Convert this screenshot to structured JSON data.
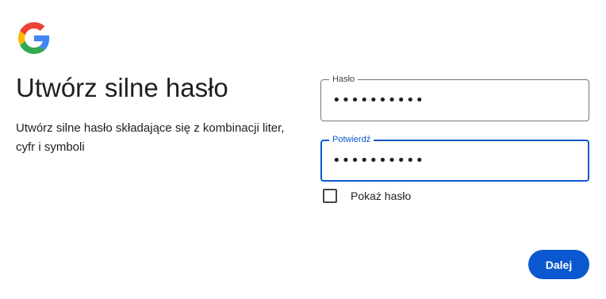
{
  "brand": {
    "logo": "google-g-logo",
    "colors": {
      "blue": "#4285F4",
      "red": "#EA4335",
      "yellow": "#FBBC05",
      "green": "#34A853",
      "accent": "#0b57d0"
    }
  },
  "heading": {
    "title": "Utwórz silne hasło",
    "subtitle": "Utwórz silne hasło składające się z kombinacji liter, cyfr i symboli"
  },
  "form": {
    "password": {
      "label": "Hasło",
      "value": "••••••••••"
    },
    "confirm": {
      "label": "Potwierdź",
      "value": "••••••••••",
      "focused": true
    },
    "show_password": {
      "label": "Pokaż hasło",
      "checked": false
    }
  },
  "actions": {
    "next_label": "Dalej"
  }
}
